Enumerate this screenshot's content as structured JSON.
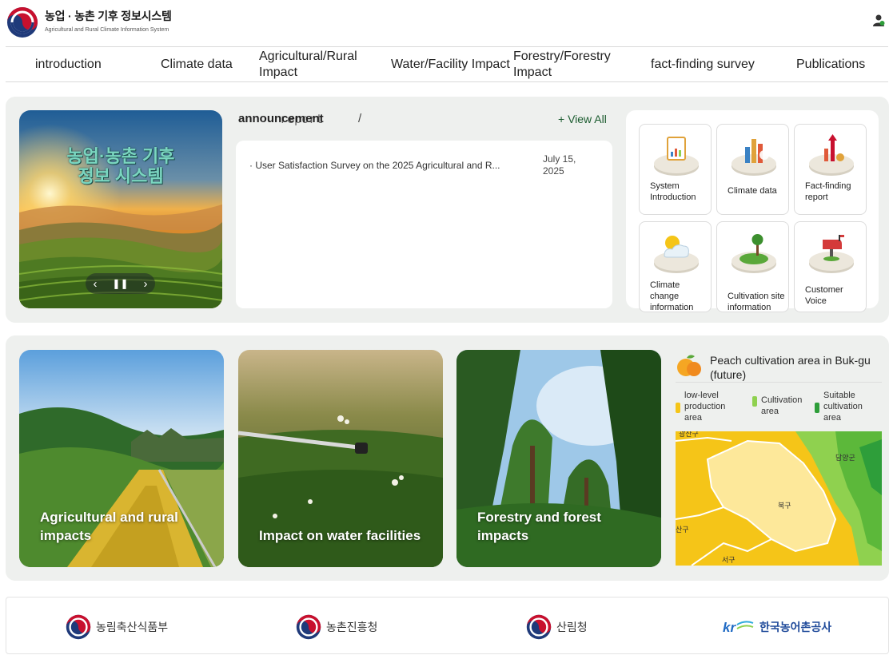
{
  "header": {
    "brand_title": "농업 · 농촌 기후 정보시스템",
    "brand_subtitle": "Agricultural and Rural Climate Information System"
  },
  "nav": {
    "items": [
      {
        "label": "introduction"
      },
      {
        "label": "Climate data"
      },
      {
        "label": "Agricultural/Rural Impact"
      },
      {
        "label": "Water/Facility Impact"
      },
      {
        "label": "Forestry/Forestry Impact"
      },
      {
        "label": "fact-finding survey"
      },
      {
        "label": "Publications"
      }
    ]
  },
  "hero": {
    "title_line1": "농업·농촌 기후",
    "title_line2": "정보 시스템",
    "prev": "‹",
    "pause": "⏸",
    "next": "›"
  },
  "notices": {
    "tab_announcement": "announcement",
    "tab_report": "report",
    "separator": "/",
    "view_all": "+ View All",
    "items": [
      {
        "title": "· User Satisfaction Survey on the 2025 Agricultural and R...",
        "date": "July 15, 2025"
      }
    ]
  },
  "quick_links": [
    {
      "label": "System Introduction",
      "icon": "document-chart-icon"
    },
    {
      "label": "Climate data",
      "icon": "bar-chart-icon"
    },
    {
      "label": "Fact-finding report",
      "icon": "growth-arrow-icon"
    },
    {
      "label": "Climate change information",
      "icon": "sun-cloud-icon"
    },
    {
      "label": "Cultivation site information",
      "icon": "tree-globe-icon"
    },
    {
      "label": "Customer Voice",
      "icon": "mailbox-icon"
    }
  ],
  "impact_cards": [
    {
      "label": "Agricultural and rural impacts"
    },
    {
      "label": "Impact on water facilities"
    },
    {
      "label": "Forestry and forest impacts"
    }
  ],
  "map_widget": {
    "title": "Peach cultivation area in Buk-gu (future)",
    "legend": [
      {
        "label": "low-level production area",
        "color": "#f5c518"
      },
      {
        "label": "Cultivation area",
        "color": "#8fd14f"
      },
      {
        "label": "Suitable cultivation area",
        "color": "#2e9e3a"
      }
    ],
    "place_labels": {
      "top_left": "광산구",
      "right": "담양군",
      "center": "북구",
      "left": "산구",
      "bottom": "서구"
    }
  },
  "footer": {
    "orgs": [
      {
        "label": "농림축산식품부"
      },
      {
        "label": "농촌진흥청"
      },
      {
        "label": "산림청"
      },
      {
        "label": "한국농어촌공사"
      }
    ]
  }
}
